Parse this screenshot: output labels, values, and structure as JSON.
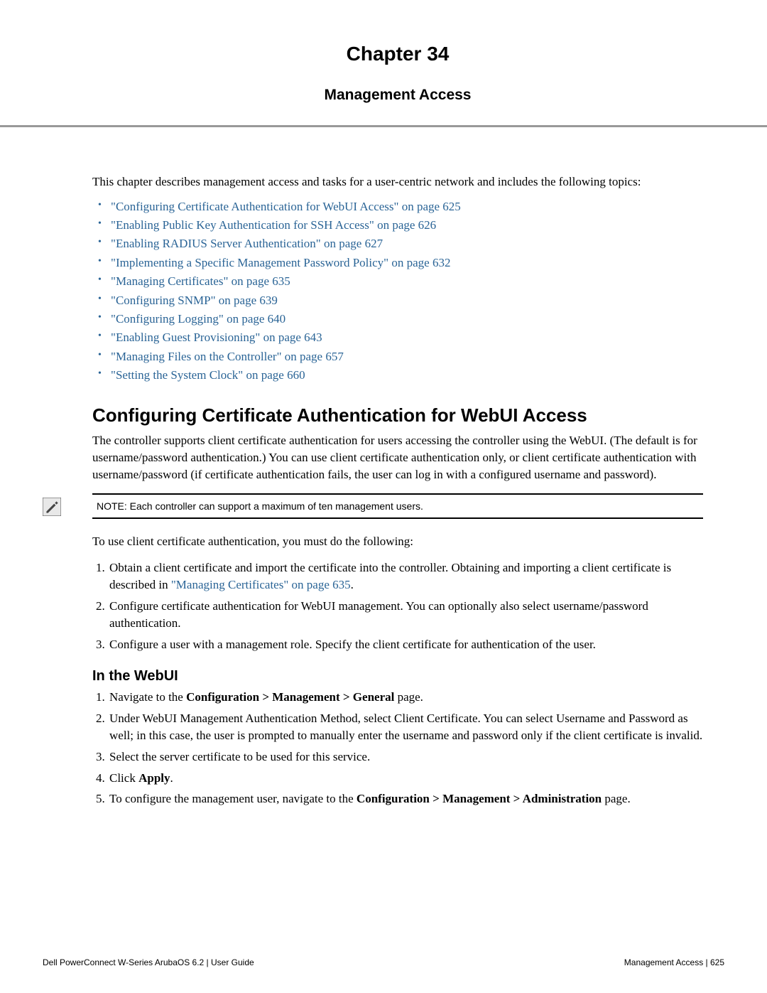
{
  "header": {
    "chapter": "Chapter 34",
    "title": "Management Access"
  },
  "intro": "This chapter describes management access and tasks for a user-centric network and includes the following topics:",
  "toc": [
    "\"Configuring Certificate Authentication for WebUI Access\" on page 625",
    "\"Enabling Public Key Authentication for SSH Access\" on page 626",
    "\"Enabling RADIUS Server Authentication\" on page 627",
    "\"Implementing a Specific Management Password Policy\" on page 632",
    "\"Managing Certificates\" on page 635",
    "\"Configuring SNMP\" on page 639",
    "\"Configuring Logging\" on page 640",
    "\"Enabling Guest Provisioning\" on page 643",
    "\"Managing Files on the Controller\" on page 657",
    "\"Setting the System Clock\" on page 660"
  ],
  "section1": {
    "heading": "Configuring Certificate Authentication for WebUI Access",
    "body": "The controller supports client certificate authentication for users accessing the controller using the WebUI. (The default is for username/password authentication.) You can use client certificate authentication only, or client certificate authentication with username/password (if certificate authentication fails, the user can log in with a configured username and password).",
    "note": "NOTE: Each controller can support a maximum of ten management users.",
    "lead": "To use client certificate authentication, you must do the following:",
    "steps": {
      "s1_pre": "Obtain a client certificate and import the certificate into the controller. Obtaining and importing a client certificate is described in ",
      "s1_link": "\"Managing Certificates\" on page 635",
      "s1_post": ".",
      "s2": "Configure certificate authentication for WebUI management. You can optionally also select username/password authentication.",
      "s3": "Configure a user with a management role. Specify the client certificate for authentication of the user."
    },
    "webui_heading": "In the WebUI",
    "webui_steps": {
      "w1_pre": "Navigate to the ",
      "w1_bold": "Configuration > Management > General",
      "w1_post": " page.",
      "w2": "Under WebUI Management Authentication Method, select Client Certificate. You can select Username and Password as well; in this case, the user is prompted to manually enter the username and password only if the client certificate is invalid.",
      "w3": "Select the server certificate to be used for this service.",
      "w4_pre": "Click ",
      "w4_bold": "Apply",
      "w4_post": ".",
      "w5_pre": "To configure the management user, navigate to the ",
      "w5_bold": "Configuration > Management > Administration",
      "w5_post": " page."
    }
  },
  "footer": {
    "left": "Dell PowerConnect W-Series ArubaOS 6.2  |  User Guide",
    "right": "Management Access | 625"
  }
}
